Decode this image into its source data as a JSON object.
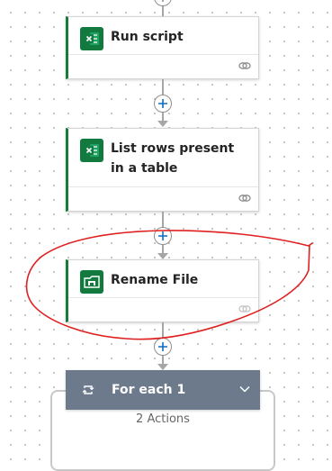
{
  "flow": {
    "steps": [
      {
        "title": "Run script",
        "icon": "excel-icon",
        "accent": "#1a7a3a"
      },
      {
        "title": "List rows present in a table",
        "icon": "excel-icon",
        "accent": "#1a7a3a"
      },
      {
        "title": "Rename File",
        "icon": "onedrive-file-icon",
        "accent": "#1a7a3a"
      }
    ],
    "foreach": {
      "title": "For each 1",
      "actions_count": "2 Actions",
      "header_color": "#6c7a8c"
    },
    "annotation_color": "#e02020"
  }
}
